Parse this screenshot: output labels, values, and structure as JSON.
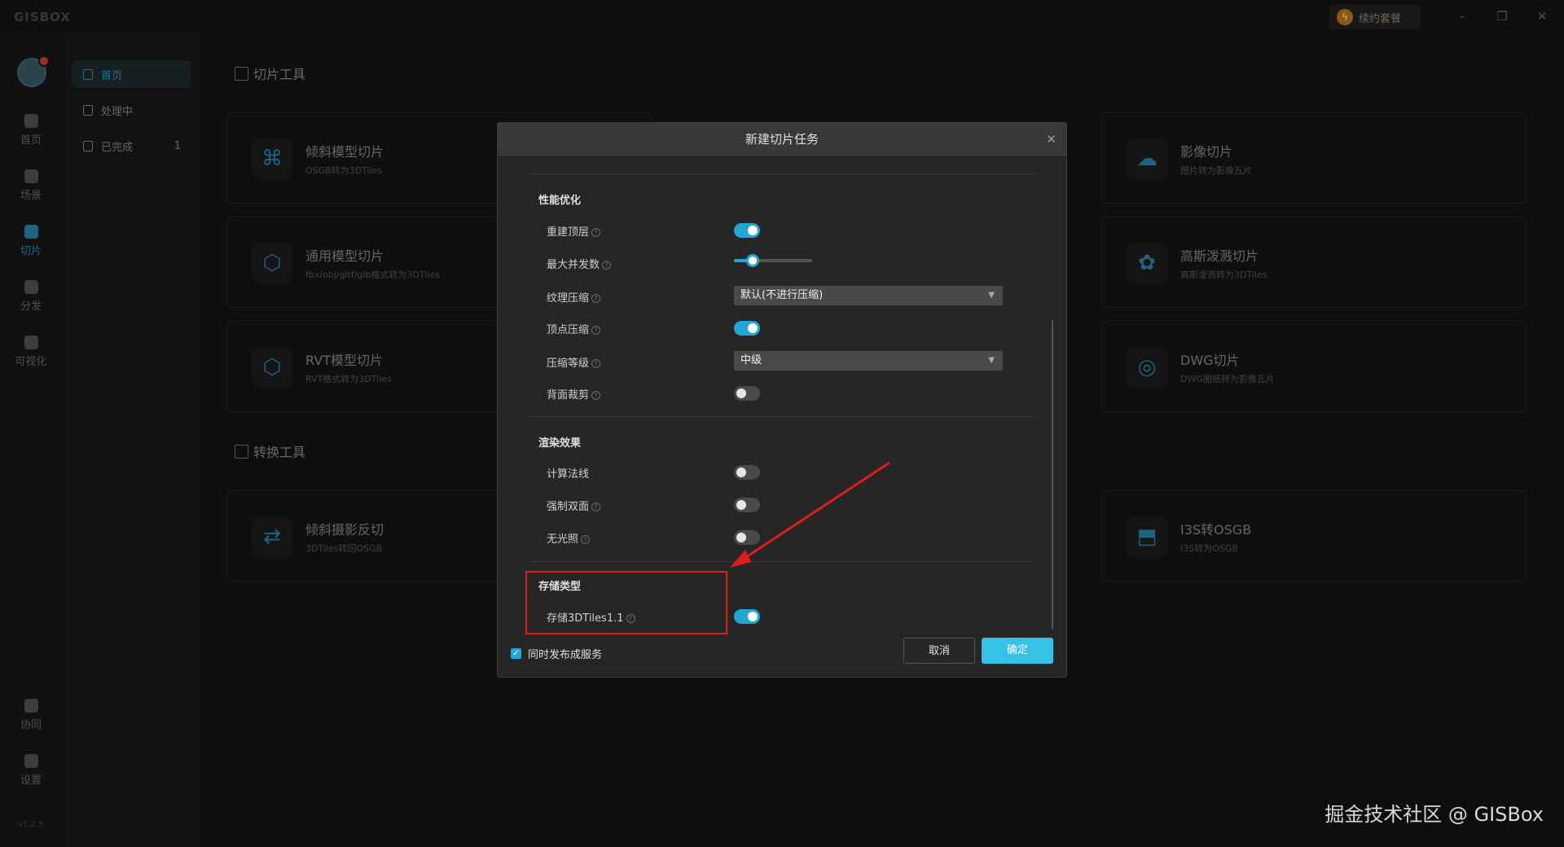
{
  "app": {
    "logo": "GISBOX",
    "renew": "续约套餐",
    "version": "v1.2.5"
  },
  "window": {
    "minimize": "–",
    "restore": "❐",
    "close": "✕"
  },
  "sidebar": {
    "items": [
      {
        "label": "首页",
        "icon": "home-icon"
      },
      {
        "label": "场景",
        "icon": "scene-icon"
      },
      {
        "label": "切片",
        "icon": "slice-icon"
      },
      {
        "label": "分发",
        "icon": "distribute-icon"
      },
      {
        "label": "可视化",
        "icon": "visual-icon"
      },
      {
        "label": "协同",
        "icon": "collab-icon"
      },
      {
        "label": "设置",
        "icon": "settings-icon"
      }
    ]
  },
  "subnav": {
    "items": [
      {
        "label": "首页",
        "count": ""
      },
      {
        "label": "处理中",
        "count": ""
      },
      {
        "label": "已完成",
        "count": "1"
      }
    ]
  },
  "sections": {
    "slice": "切片工具",
    "convert": "转换工具"
  },
  "cards": [
    {
      "title": "倾斜模型切片",
      "sub": "OSGB转为3DTiles",
      "icon": "⌘"
    },
    {
      "title": "影像切片",
      "sub": "图片转为影像瓦片",
      "icon": "☁"
    },
    {
      "title": "通用模型切片",
      "sub": "fbx/obj/gltf/glb格式转为3DTiles",
      "icon": "⬡"
    },
    {
      "title": "高斯泼溅切片",
      "sub": "高斯泼溅转为3DTiles",
      "icon": "✿"
    },
    {
      "title": "RVT模型切片",
      "sub": "RVT格式转为3DTiles",
      "icon": "⬡"
    },
    {
      "title": "DWG切片",
      "sub": "DWG图纸转为影像瓦片",
      "icon": "◎"
    },
    {
      "title": "倾斜摄影反切",
      "sub": "3DTiles转回OSGB",
      "icon": "⇄"
    },
    {
      "title": "I3S转OSGB",
      "sub": "I3S转为OSGB",
      "icon": "⬒"
    }
  ],
  "modal": {
    "title": "新建切片任务",
    "close": "✕",
    "groups": {
      "perf": "性能优化",
      "render": "渲染效果",
      "storage": "存储类型"
    },
    "rows": {
      "rebuild_top": {
        "label": "重建顶层",
        "on": true
      },
      "max_concurrency": {
        "label": "最大并发数",
        "value": 0.24
      },
      "texture_compress": {
        "label": "纹理压缩",
        "value": "默认(不进行压缩)"
      },
      "vertex_compress": {
        "label": "顶点压缩",
        "on": true
      },
      "compress_level": {
        "label": "压缩等级",
        "value": "中级"
      },
      "backface_cull": {
        "label": "背面裁剪",
        "on": false
      },
      "calc_normals": {
        "label": "计算法线",
        "on": false
      },
      "force_double": {
        "label": "强制双面",
        "on": false
      },
      "no_lighting": {
        "label": "无光照",
        "on": false
      },
      "store_3dtiles": {
        "label": "存储3DTiles1.1",
        "on": true
      }
    },
    "publish_service": "同时发布成服务",
    "cancel": "取消",
    "confirm": "确定"
  },
  "watermark": "掘金技术社区 @ GISBox",
  "colors": {
    "accent": "#23a6d6",
    "highlight": "#e11c1c"
  }
}
